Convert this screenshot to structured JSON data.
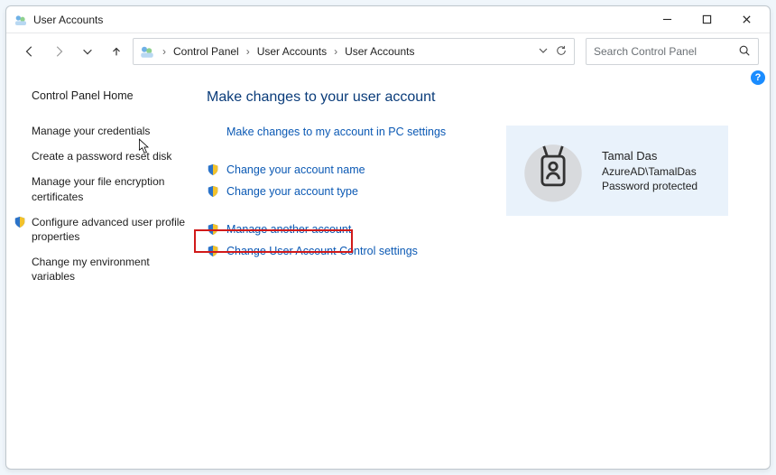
{
  "window": {
    "title": "User Accounts"
  },
  "breadcrumb": {
    "root": "Control Panel",
    "level1": "User Accounts",
    "level2": "User Accounts"
  },
  "search": {
    "placeholder": "Search Control Panel"
  },
  "sidebar": {
    "home": "Control Panel Home",
    "items": [
      "Manage your credentials",
      "Create a password reset disk",
      "Manage your file encryption certificates",
      "Configure advanced user profile properties",
      "Change my environment variables"
    ]
  },
  "main": {
    "heading": "Make changes to your user account",
    "top_link": "Make changes to my account in PC settings",
    "actions": {
      "change_name": "Change your account name",
      "change_type": "Change your account type",
      "manage_another": "Manage another account",
      "change_uac": "Change User Account Control settings"
    }
  },
  "user": {
    "name": "Tamal Das",
    "domain": "AzureAD\\TamalDas",
    "status": "Password protected"
  },
  "help_badge": "?"
}
